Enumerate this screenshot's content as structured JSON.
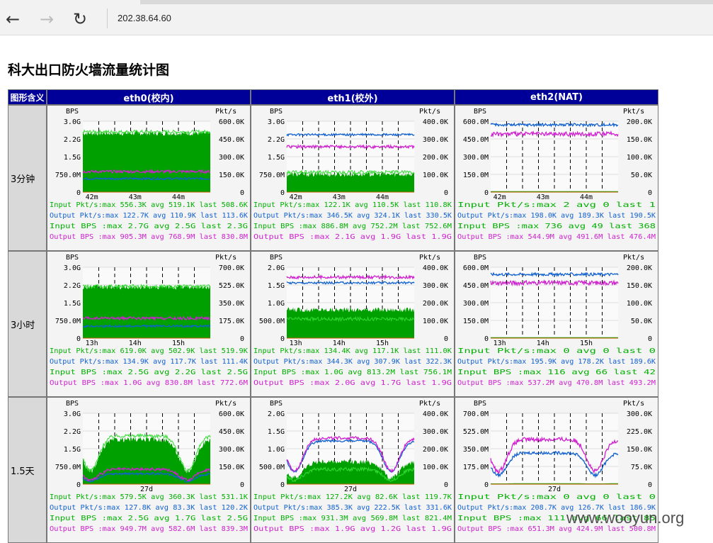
{
  "browser": {
    "address": "202.38.64.60",
    "back_icon": "arrow-left-icon",
    "forward_icon": "arrow-right-icon",
    "reload_icon": "reload-icon"
  },
  "page": {
    "title": "科大出口防火墙流量统计图",
    "corner_header": "图形含义",
    "columns": [
      "eth0(校内)",
      "eth1(校外)",
      "eth2(NAT)"
    ],
    "rows": [
      "3分钟",
      "3小时",
      "1.5天"
    ]
  },
  "watermark": "www.wooyun.org",
  "chart_data": [
    {
      "id": "eth0-3m",
      "type": "area",
      "y_left_label": "BPS",
      "y_right_label": "Pkt/s",
      "y_left_ticks": [
        "0",
        "750.0M",
        "1.5G",
        "2.2G",
        "3.0G"
      ],
      "y_right_ticks": [
        "0",
        "150.0K",
        "300.0K",
        "450.0K",
        "600.0K"
      ],
      "x_ticks": [
        "42m",
        "43m",
        "44m"
      ],
      "series_levels": {
        "input_bps": 0.83,
        "output_bps": 0.29,
        "input_pkts": 0.85,
        "output_pkts": 0.19
      },
      "legend": [
        {
          "name": "Input",
          "kind": "Pkt/s",
          "max": "556.3K",
          "avg": "519.1K",
          "last": "508.6K"
        },
        {
          "name": "Output",
          "kind": "Pkt/s",
          "max": "122.7K",
          "avg": "110.9K",
          "last": "113.6K"
        },
        {
          "name": "Input",
          "kind": "BPS",
          "max": "2.7G",
          "avg": "2.5G",
          "last": "2.3G"
        },
        {
          "name": "Output",
          "kind": "BPS",
          "max": "905.3M",
          "avg": "768.9M",
          "last": "830.8M"
        }
      ]
    },
    {
      "id": "eth1-3m",
      "type": "area",
      "y_left_label": "BPS",
      "y_right_label": "Pkt/s",
      "y_left_ticks": [
        "0",
        "750.0M",
        "1.5G",
        "2.2G",
        "3.0G"
      ],
      "y_right_ticks": [
        "0",
        "100.0K",
        "200.0K",
        "300.0K",
        "400.0K"
      ],
      "x_ticks": [
        "42m",
        "43m",
        "44m"
      ],
      "series_levels": {
        "input_bps": 0.25,
        "output_bps": 0.64,
        "input_pkts": 0.28,
        "output_pkts": 0.81
      },
      "legend": [
        {
          "name": "Input",
          "kind": "Pkt/s",
          "max": "122.1K",
          "avg": "110.5K",
          "last": "110.8K"
        },
        {
          "name": "Output",
          "kind": "Pkt/s",
          "max": "346.5K",
          "avg": "324.1K",
          "last": "330.5K"
        },
        {
          "name": "Input",
          "kind": "BPS",
          "max": "886.8M",
          "avg": "752.2M",
          "last": "752.6M"
        },
        {
          "name": "Output",
          "kind": "BPS",
          "max": "2.1G",
          "avg": "1.9G",
          "last": "1.9G"
        }
      ]
    },
    {
      "id": "eth2-3m",
      "type": "line",
      "y_left_label": "BPS",
      "y_right_label": "Pkt/s",
      "y_left_ticks": [
        "0",
        "150.0M",
        "300.0M",
        "450.0M",
        "600.0M"
      ],
      "y_right_ticks": [
        "0",
        "50.0K",
        "100.0K",
        "150.0K",
        "200.0K"
      ],
      "x_ticks": [
        "42m",
        "43m",
        "44m"
      ],
      "series_levels": {
        "input_bps": 0.005,
        "output_bps": 0.82,
        "input_pkts": 0.005,
        "output_pkts": 0.95
      },
      "legend": [
        {
          "name": "Input",
          "kind": "Pkt/s",
          "max": "2",
          "avg": "0",
          "last": "1"
        },
        {
          "name": "Output",
          "kind": "Pkt/s",
          "max": "198.0K",
          "avg": "189.3K",
          "last": "190.5K"
        },
        {
          "name": "Input",
          "kind": "BPS",
          "max": "736",
          "avg": "49",
          "last": "368"
        },
        {
          "name": "Output",
          "kind": "BPS",
          "max": "544.9M",
          "avg": "491.6M",
          "last": "476.4M"
        }
      ]
    },
    {
      "id": "eth0-3h",
      "type": "area",
      "y_left_label": "BPS",
      "y_right_label": "Pkt/s",
      "y_left_ticks": [
        "0",
        "750.0M",
        "1.5G",
        "2.2G",
        "3.0G"
      ],
      "y_right_ticks": [
        "0",
        "175.0K",
        "350.0K",
        "525.0K",
        "700.0K"
      ],
      "x_ticks": [
        "13h",
        "14h",
        "15h"
      ],
      "series_levels": {
        "input_bps": 0.72,
        "output_bps": 0.28,
        "input_pkts": 0.73,
        "output_pkts": 0.17
      },
      "legend": [
        {
          "name": "Input",
          "kind": "Pkt/s",
          "max": "619.0K",
          "avg": "502.9K",
          "last": "519.9K"
        },
        {
          "name": "Output",
          "kind": "Pkt/s",
          "max": "134.9K",
          "avg": "117.7K",
          "last": "111.4K"
        },
        {
          "name": "Input",
          "kind": "BPS",
          "max": "2.5G",
          "avg": "2.2G",
          "last": "2.5G"
        },
        {
          "name": "Output",
          "kind": "BPS",
          "max": "1.0G",
          "avg": "830.8M",
          "last": "772.6M"
        }
      ]
    },
    {
      "id": "eth1-3h",
      "type": "area",
      "y_left_label": "BPS",
      "y_right_label": "Pkt/s",
      "y_left_ticks": [
        "0",
        "500.0M",
        "1.0G",
        "1.5G",
        "2.0G"
      ],
      "y_right_ticks": [
        "0",
        "100.0K",
        "200.0K",
        "300.0K",
        "400.0K"
      ],
      "x_ticks": [
        "13h",
        "14h",
        "15h"
      ],
      "series_levels": {
        "input_bps": 0.4,
        "output_bps": 0.86,
        "input_pkts": 0.27,
        "output_pkts": 0.78
      },
      "legend": [
        {
          "name": "Input",
          "kind": "Pkt/s",
          "max": "134.4K",
          "avg": "117.1K",
          "last": "111.0K"
        },
        {
          "name": "Output",
          "kind": "Pkt/s",
          "max": "344.3K",
          "avg": "307.9K",
          "last": "322.3K"
        },
        {
          "name": "Input",
          "kind": "BPS",
          "max": "1.0G",
          "avg": "813.2M",
          "last": "756.1M"
        },
        {
          "name": "Output",
          "kind": "BPS",
          "max": "2.0G",
          "avg": "1.7G",
          "last": "1.9G"
        }
      ]
    },
    {
      "id": "eth2-3h",
      "type": "line",
      "y_left_label": "BPS",
      "y_right_label": "Pkt/s",
      "y_left_ticks": [
        "0",
        "150.0M",
        "300.0M",
        "450.0M",
        "600.0M"
      ],
      "y_right_ticks": [
        "0",
        "50.0K",
        "100.0K",
        "150.0K",
        "200.0K"
      ],
      "x_ticks": [
        "13h",
        "14h",
        "15h"
      ],
      "series_levels": {
        "input_bps": 0.005,
        "output_bps": 0.78,
        "input_pkts": 0.005,
        "output_pkts": 0.9
      },
      "legend": [
        {
          "name": "Input",
          "kind": "Pkt/s",
          "max": "0",
          "avg": "0",
          "last": "0"
        },
        {
          "name": "Output",
          "kind": "Pkt/s",
          "max": "195.9K",
          "avg": "178.2K",
          "last": "189.6K"
        },
        {
          "name": "Input",
          "kind": "BPS",
          "max": "116",
          "avg": "66",
          "last": "42"
        },
        {
          "name": "Output",
          "kind": "BPS",
          "max": "537.2M",
          "avg": "470.8M",
          "last": "493.2M"
        }
      ]
    },
    {
      "id": "eth0-1.5d",
      "type": "area",
      "y_left_label": "BPS",
      "y_right_label": "Pkt/s",
      "y_left_ticks": [
        "0",
        "750.0M",
        "1.5G",
        "2.2G",
        "3.0G"
      ],
      "y_right_ticks": [
        "0",
        "150.0K",
        "300.0K",
        "450.0K",
        "600.0K"
      ],
      "x_ticks": [
        "27d"
      ],
      "diurnal": true,
      "series_levels": {
        "input_bps": 0.6,
        "output_bps": 0.2,
        "input_pkts": 0.65,
        "output_pkts": 0.14
      },
      "legend": [
        {
          "name": "Input",
          "kind": "Pkt/s",
          "max": "579.5K",
          "avg": "360.3K",
          "last": "531.1K"
        },
        {
          "name": "Output",
          "kind": "Pkt/s",
          "max": "127.8K",
          "avg": "83.3K",
          "last": "120.2K"
        },
        {
          "name": "Input",
          "kind": "BPS",
          "max": "2.5G",
          "avg": "1.7G",
          "last": "2.5G"
        },
        {
          "name": "Output",
          "kind": "BPS",
          "max": "949.7M",
          "avg": "582.6M",
          "last": "839.3M"
        }
      ]
    },
    {
      "id": "eth1-1.5d",
      "type": "area",
      "y_left_label": "BPS",
      "y_right_label": "Pkt/s",
      "y_left_ticks": [
        "0",
        "500.0M",
        "1.0G",
        "1.5G",
        "2.0G"
      ],
      "y_right_ticks": [
        "0",
        "100.0K",
        "200.0K",
        "300.0K",
        "400.0K"
      ],
      "x_ticks": [
        "27d"
      ],
      "diurnal": true,
      "series_levels": {
        "input_bps": 0.3,
        "output_bps": 0.62,
        "input_pkts": 0.2,
        "output_pkts": 0.58
      },
      "legend": [
        {
          "name": "Input",
          "kind": "Pkt/s",
          "max": "127.2K",
          "avg": "82.6K",
          "last": "119.7K"
        },
        {
          "name": "Output",
          "kind": "Pkt/s",
          "max": "385.3K",
          "avg": "222.5K",
          "last": "331.6K"
        },
        {
          "name": "Input",
          "kind": "BPS",
          "max": "931.3M",
          "avg": "569.8M",
          "last": "821.4M"
        },
        {
          "name": "Output",
          "kind": "BPS",
          "max": "1.9G",
          "avg": "1.2G",
          "last": "1.9G"
        }
      ]
    },
    {
      "id": "eth2-1.5d",
      "type": "line",
      "y_left_label": "BPS",
      "y_right_label": "Pkt/s",
      "y_left_ticks": [
        "0",
        "175.0M",
        "350.0M",
        "525.0M",
        "700.0M"
      ],
      "y_right_ticks": [
        "0",
        "75.0K",
        "150.0K",
        "225.0K",
        "300.0K"
      ],
      "x_ticks": [
        "27d"
      ],
      "diurnal": true,
      "series_levels": {
        "input_bps": 0.005,
        "output_bps": 0.6,
        "input_pkts": 0.005,
        "output_pkts": 0.42
      },
      "legend": [
        {
          "name": "Input",
          "kind": "Pkt/s",
          "max": "0",
          "avg": "0",
          "last": "0"
        },
        {
          "name": "Output",
          "kind": "Pkt/s",
          "max": "208.7K",
          "avg": "126.7K",
          "last": "186.9K"
        },
        {
          "name": "Input",
          "kind": "BPS",
          "max": "111",
          "avg": "66",
          "last": "85"
        },
        {
          "name": "Output",
          "kind": "BPS",
          "max": "651.3M",
          "avg": "424.9M",
          "last": "500.8M"
        }
      ]
    }
  ]
}
